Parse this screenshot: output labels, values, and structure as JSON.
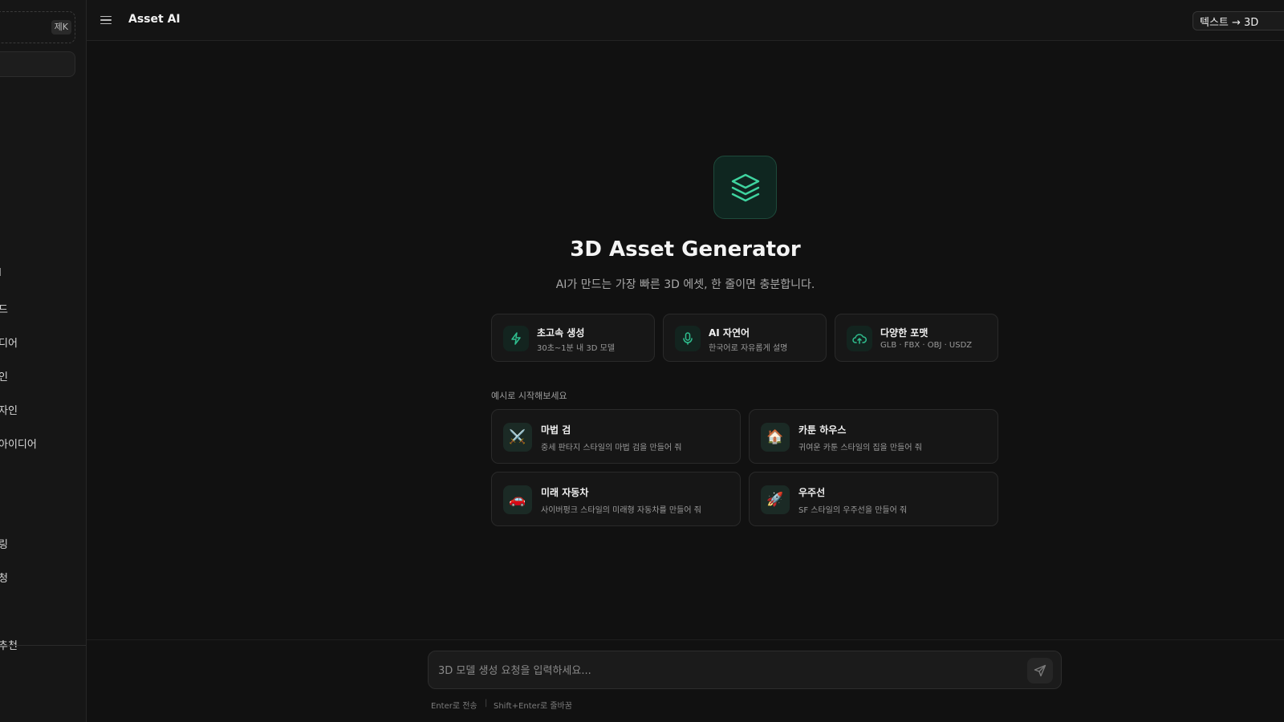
{
  "app": {
    "title": "Asset AI"
  },
  "sidebar": {
    "badge": "제K",
    "items": [
      {
        "label": "I"
      },
      {
        "label": "드"
      },
      {
        "label": "디어"
      },
      {
        "label": "인"
      },
      {
        "label": "자인"
      },
      {
        "label": "아이디어"
      },
      {
        "label": "링"
      },
      {
        "label": "청"
      },
      {
        "label": "추천"
      }
    ]
  },
  "header": {
    "mode_label": "텍스트 → 3D",
    "mode_chevron": "∨"
  },
  "hero": {
    "icon": "layers-icon",
    "title": "3D Asset Generator",
    "subtitle": "AI가 만드는 가장 빠른 3D 에셋, 한 줄이면 충분합니다."
  },
  "features": [
    {
      "icon": "lightning-icon",
      "title": "초고속 생성",
      "desc": "30초~1분 내 3D 모델"
    },
    {
      "icon": "microphone-icon",
      "title": "AI 자연어",
      "desc": "한국어로 자유롭게 설명"
    },
    {
      "icon": "cloud-upload-icon",
      "title": "다양한 포맷",
      "desc": "GLB · FBX · OBJ · USDZ"
    }
  ],
  "examples_label": "예시로 시작해보세요",
  "examples": [
    {
      "emoji": "⚔️",
      "title": "마법 검",
      "desc": "중세 판타지 스타일의 마법 검을 만들어 줘"
    },
    {
      "emoji": "🏠",
      "title": "카툰 하우스",
      "desc": "귀여운 카툰 스타일의 집을 만들어 줘"
    },
    {
      "emoji": "🚗",
      "title": "미래 자동차",
      "desc": "사이버펑크 스타일의 미래형 자동차를 만들어 줘"
    },
    {
      "emoji": "🚀",
      "title": "우주선",
      "desc": "SF 스타일의 우주선을 만들어 줘"
    }
  ],
  "prompt": {
    "placeholder": "3D 모델 생성 요청을 입력하세요...",
    "value": "",
    "hint_send": "Enter로 전송",
    "hint_sep": "|",
    "hint_newline": "Shift+Enter로 줄바꿈"
  },
  "colors": {
    "accent": "#2fbf8f",
    "background": "#111111",
    "card": "#171717"
  }
}
